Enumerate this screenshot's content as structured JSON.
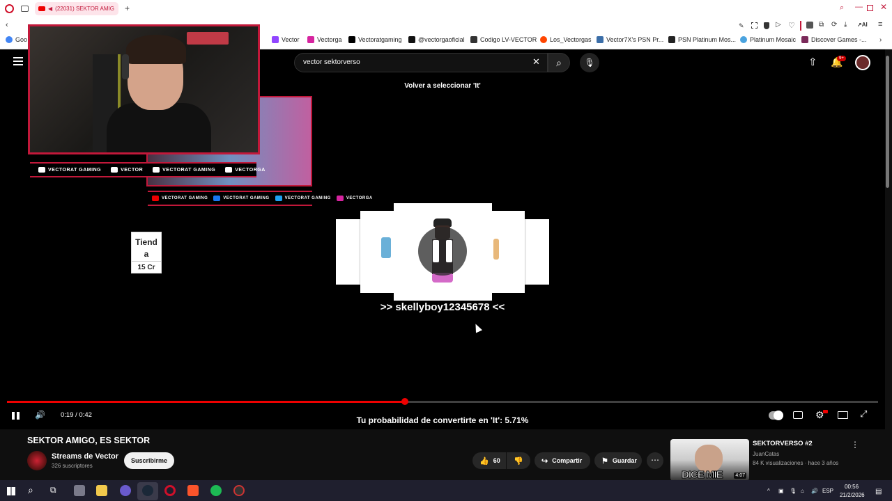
{
  "browser": {
    "tab_title": "(22031) SEKTOR AMIG",
    "bookmarks": [
      "Vector",
      "Vectorga",
      "Vectoratgaming",
      "@vectorgaoficial",
      "Codigo LV-VECTOR",
      "Los_Vectorgas",
      "Vector7X's PSN Pr...",
      "PSN Platinum Mos...",
      "Platinum Mosaic",
      "Discover Games -..."
    ],
    "bookmark_first": "Goo",
    "ai_label": "AI"
  },
  "youtube": {
    "search_value": "vector sektorverso",
    "notif_badge": "9+"
  },
  "stream_overlay": {
    "social": [
      "VECTORAT GAMING",
      "VECTOR",
      "VECTORAT GAMING",
      "VECTORGA"
    ],
    "social2": [
      "VECTORAT GAMING",
      "VECTORAT GAMING",
      "VECTORAT GAMING",
      "VECTORGA"
    ]
  },
  "game": {
    "volver": "Volver a seleccionar 'It'",
    "tienda_line1": "Tiend",
    "tienda_line2": "a",
    "tienda_price": "15 Cr",
    "username": ">> skellyboy12345678 <<"
  },
  "player": {
    "time": "0:19 / 0:42",
    "progress_fraction": 0.457,
    "probability_text": "Tu probabilidad de convertirte en 'It': 5.71%"
  },
  "video": {
    "title": "SEKTOR AMIGO, ES SEKTOR",
    "channel": "Streams de Vector",
    "subs": "326 suscriptores",
    "subscribe": "Suscribirme",
    "likes": "60",
    "share": "Compartir",
    "save": "Guardar"
  },
  "recommended": {
    "title": "SEKTORVERSO #2",
    "channel": "JuanCatas",
    "meta": "84 K visualizaciones · hace 3 años",
    "duration": "4:07",
    "thumb_text": "DICE MIE"
  },
  "taskbar": {
    "lang": "ESP",
    "time": "00:56",
    "date": "21/2/2026"
  },
  "colors": {
    "accent_red": "#c2183a",
    "progress_red": "#ee0000",
    "bg": "#0f0f0f"
  }
}
